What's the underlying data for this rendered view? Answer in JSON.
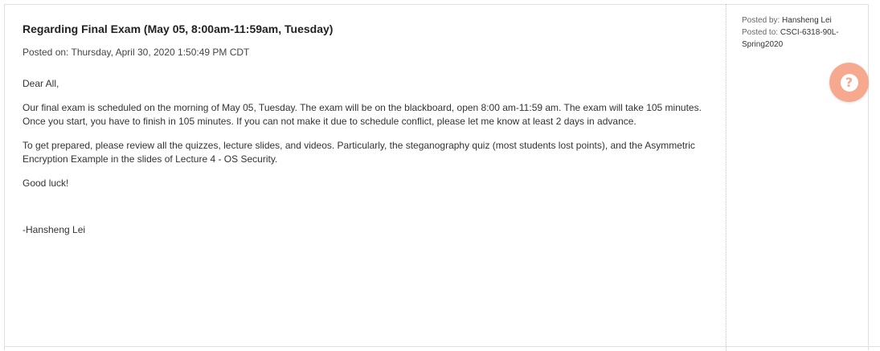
{
  "announcement": {
    "title": "Regarding Final Exam (May 05, 8:00am-11:59am, Tuesday)",
    "posted_on": "Posted on: Thursday, April 30, 2020 1:50:49 PM CDT",
    "body": {
      "greeting": "Dear All,",
      "para1": "Our final exam is scheduled on the morning of May 05, Tuesday. The exam will be on the blackboard, open 8:00 am-11:59 am. The exam will take 105 minutes. Once you start, you have to finish in 105 minutes.  If you can not make it due to schedule conflict, please let me know at least 2 days in advance.",
      "para2": "To get prepared, please review all the quizzes, lecture slides, and videos. Particularly, the steganography quiz (most students lost points), and the Asymmetric Encryption Example in the slides of Lecture 4 -  OS Security.",
      "closing": "Good luck!",
      "signature": "-Hansheng Lei"
    }
  },
  "meta": {
    "posted_by_label": "Posted by:",
    "posted_by": "Hansheng Lei",
    "posted_to_label": "Posted to:",
    "posted_to": "CSCI-6318-90L-Spring2020"
  },
  "help_button": {
    "icon": "question-mark-icon",
    "glyph": "?",
    "color": "#f6a98f"
  }
}
